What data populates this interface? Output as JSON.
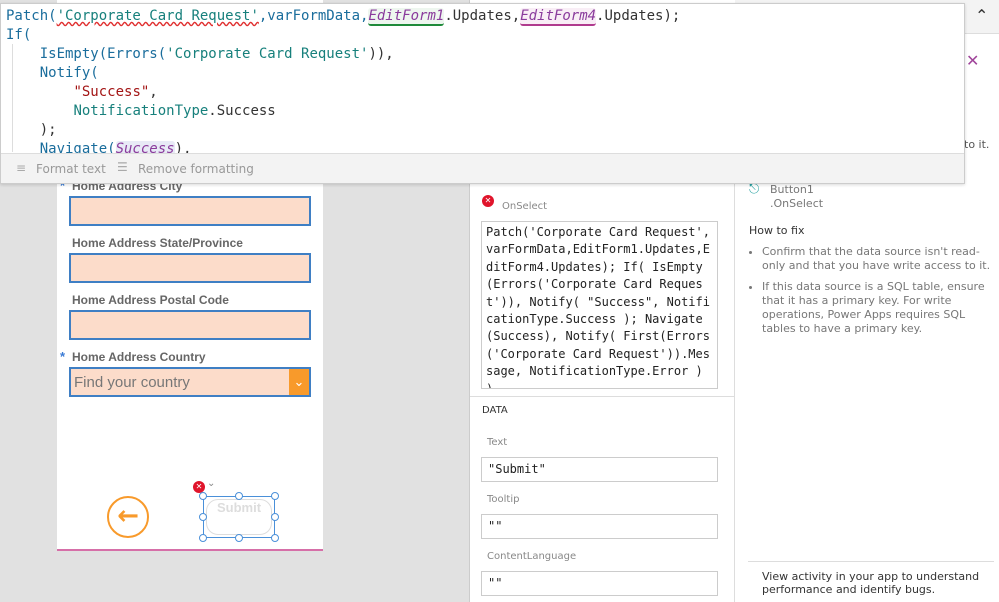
{
  "formula_bar": {
    "lines": [
      [
        [
          "t-fn",
          "Patch("
        ],
        [
          "t-str sq",
          "'Corporate Card Request'"
        ],
        [
          "t-fn",
          ",varFormData,"
        ],
        [
          "t-id ctl1",
          "EditForm1"
        ],
        [
          "",
          "."
        ],
        [
          "",
          "Updates,"
        ],
        [
          "t-id ctl4",
          "EditForm4"
        ],
        [
          "",
          ".Updates);"
        ]
      ],
      [
        [
          "t-fn",
          "If("
        ]
      ],
      [
        [
          "",
          "    "
        ],
        [
          "t-fn",
          "IsEmpty(Errors("
        ],
        [
          "t-str",
          "'Corporate Card Request'"
        ],
        [
          "",
          ")),"
        ]
      ],
      [
        [
          "",
          "    "
        ],
        [
          "t-fn",
          "Notify("
        ]
      ],
      [
        [
          "",
          "        "
        ],
        [
          "t-q",
          "\"Success\""
        ],
        [
          "",
          ","
        ]
      ],
      [
        [
          "",
          "        "
        ],
        [
          "t-k",
          "NotificationType"
        ],
        [
          "",
          ".Success"
        ]
      ],
      [
        [
          "",
          "    );"
        ]
      ],
      [
        [
          "",
          "    "
        ],
        [
          "t-fn",
          "Navigate("
        ],
        [
          "t-id scr",
          "Success"
        ],
        [
          "",
          "),"
        ]
      ]
    ],
    "format_text": "Format text",
    "remove_formatting": "Remove formatting"
  },
  "canvas": {
    "fields": [
      {
        "label": "Home Address City",
        "required": true
      },
      {
        "label": "Home Address State/Province",
        "required": false
      },
      {
        "label": "Home Address Postal Code",
        "required": false
      },
      {
        "label": "Home Address Country",
        "required": true,
        "placeholder": "Find your country"
      }
    ],
    "submit_label": "Submit",
    "accent": "#f89a2b"
  },
  "properties": {
    "onselect_label": "OnSelect",
    "onselect_value": "Patch('Corporate Card Request',varFormData,EditForm1.Updates,EditForm4.Updates); If( IsEmpty(Errors('Corporate Card Request')), Notify( \"Success\", NotificationType.Success ); Navigate(Success), Notify( First(Errors('Corporate Card Request')).Message, NotificationType.Error ) )",
    "section": "DATA",
    "text_label": "Text",
    "text_value": "\"Submit\"",
    "tooltip_label": "Tooltip",
    "tooltip_value": "\"\"",
    "lang_label": "ContentLanguage",
    "lang_value": "\"\""
  },
  "error_panel": {
    "partial_text": "to it.",
    "control": "Button1",
    "property": ".OnSelect",
    "how_to_fix": "How to fix",
    "tips": [
      "Confirm that the data source isn't read-only and that you have write access to it.",
      "If this data source is a SQL table, ensure that it has a primary key. For write operations, Power Apps requires SQL tables to have a primary key."
    ],
    "footer": "View activity in your app to understand performance and identify bugs."
  }
}
